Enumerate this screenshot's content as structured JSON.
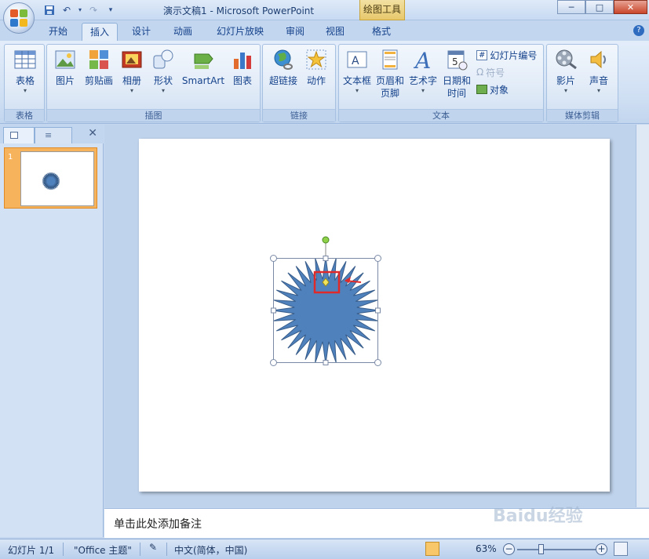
{
  "titlebar": {
    "title": "演示文稿1 - Microsoft PowerPoint",
    "context_tool": "绘图工具",
    "minimize": "─",
    "maximize": "□",
    "close": "✕"
  },
  "tabs": [
    "开始",
    "插入",
    "设计",
    "动画",
    "幻灯片放映",
    "审阅",
    "视图",
    "格式"
  ],
  "active_tab": "插入",
  "ribbon": {
    "groups": {
      "table": {
        "label": "表格",
        "buttons": {
          "table": "表格"
        }
      },
      "illustrations": {
        "label": "插图",
        "buttons": {
          "picture": "图片",
          "clipart": "剪贴画",
          "album": "相册",
          "shapes": "形状",
          "smartart": "SmartArt",
          "chart": "图表"
        }
      },
      "links": {
        "label": "链接",
        "buttons": {
          "hyperlink": "超链接",
          "action": "动作"
        }
      },
      "text": {
        "label": "文本",
        "buttons": {
          "textbox": "文本框",
          "header_footer_1": "页眉和",
          "header_footer_2": "页脚",
          "wordart": "艺术字",
          "datetime_1": "日期和",
          "datetime_2": "时间",
          "slide_number": "幻灯片编号",
          "symbol": "符号",
          "object": "对象"
        }
      },
      "media": {
        "label": "媒体剪辑",
        "buttons": {
          "movie": "影片",
          "sound": "声音"
        }
      }
    }
  },
  "slides_panel": {
    "slide_number": "1"
  },
  "notes": {
    "placeholder": "单击此处添加备注"
  },
  "statusbar": {
    "slide_info": "幻灯片 1/1",
    "theme": "\"Office 主题\"",
    "language": "中文(简体，中国)",
    "zoom": "63%"
  },
  "watermark": "Baidu经验",
  "colors": {
    "shape_fill": "#4f81bd",
    "shape_stroke": "#385d8a",
    "highlight_box": "#e02a2a",
    "selection_handle": "#ffffff",
    "rotate_handle": "#8fd24a"
  }
}
